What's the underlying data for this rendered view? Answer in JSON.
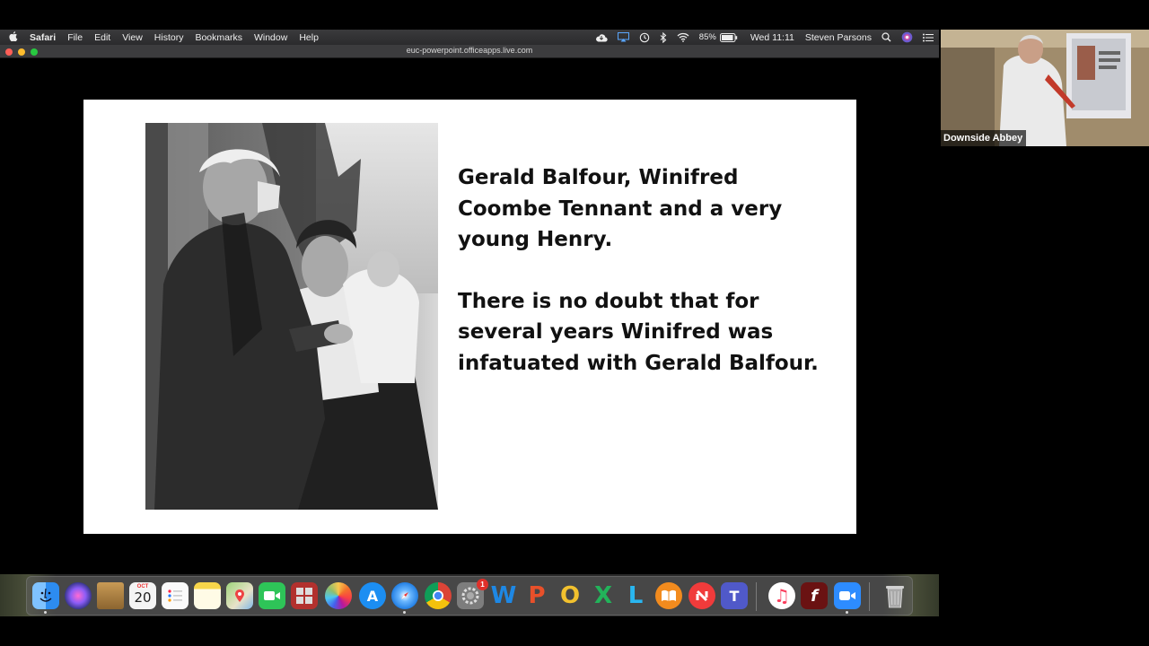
{
  "menubar": {
    "apple_icon": "apple-icon",
    "app_name": "Safari",
    "items": [
      "File",
      "Edit",
      "View",
      "History",
      "Bookmarks",
      "Window",
      "Help"
    ],
    "battery": "85%",
    "clock": "Wed 11:11",
    "user": "Steven Parsons"
  },
  "browser": {
    "url": "euc-powerpoint.officeapps.live.com",
    "traffic_colors": [
      "#fe5f57",
      "#febc2e",
      "#28c840"
    ]
  },
  "slide": {
    "paragraphs": [
      "Gerald Balfour, Winifred Coombe Tennant and a very young Henry.",
      "There is no doubt that for several years Winifred was infatuated with Gerald Balfour."
    ]
  },
  "video": {
    "participant_name": "Downside Abbey"
  },
  "dock": {
    "items": [
      {
        "name": "finder",
        "label": "",
        "color": "#2d8cf0"
      },
      {
        "name": "siri",
        "label": "",
        "color": "#5a3fc0"
      },
      {
        "name": "notefile",
        "label": "",
        "color": "#a87b3e"
      },
      {
        "name": "calendar",
        "label": "20",
        "color": "#f4f4f4"
      },
      {
        "name": "reminders",
        "label": "",
        "color": "#f8f8f8"
      },
      {
        "name": "notes",
        "label": "",
        "color": "#f7d54a"
      },
      {
        "name": "maps",
        "label": "",
        "color": "#6bbf59"
      },
      {
        "name": "facetime",
        "label": "",
        "color": "#2ec458"
      },
      {
        "name": "photo-booth",
        "label": "",
        "color": "#b2312e"
      },
      {
        "name": "photos",
        "label": "",
        "color": "#f2f2f2"
      },
      {
        "name": "app-store",
        "label": "A",
        "color": "#1c8ef2"
      },
      {
        "name": "safari",
        "label": "",
        "color": "#1a78e0"
      },
      {
        "name": "chrome",
        "label": "",
        "color": "#e8e8e8"
      },
      {
        "name": "system-preferences",
        "label": "",
        "color": "#7d7d7d"
      },
      {
        "name": "word",
        "label": "W",
        "color": "#1e6fd1"
      },
      {
        "name": "powerpoint",
        "label": "P",
        "color": "#d24726"
      },
      {
        "name": "outlook",
        "label": "O",
        "color": "#f2c12e"
      },
      {
        "name": "excel",
        "label": "X",
        "color": "#1e9e54"
      },
      {
        "name": "lync",
        "label": "L",
        "color": "#1aa3e0"
      },
      {
        "name": "books",
        "label": "",
        "color": "#f28b1e"
      },
      {
        "name": "news",
        "label": "",
        "color": "#f03b3b"
      },
      {
        "name": "teams",
        "label": "T",
        "color": "#5059c9"
      },
      {
        "name": "music",
        "label": "♫",
        "color": "#fa3d5c"
      },
      {
        "name": "flash",
        "label": "f",
        "color": "#6a1212"
      },
      {
        "name": "zoom",
        "label": "",
        "color": "#2d8cff"
      },
      {
        "name": "trash",
        "label": "",
        "color": "#8d8d8d"
      }
    ],
    "calendar_month": "OCT",
    "badge_count": "1"
  }
}
